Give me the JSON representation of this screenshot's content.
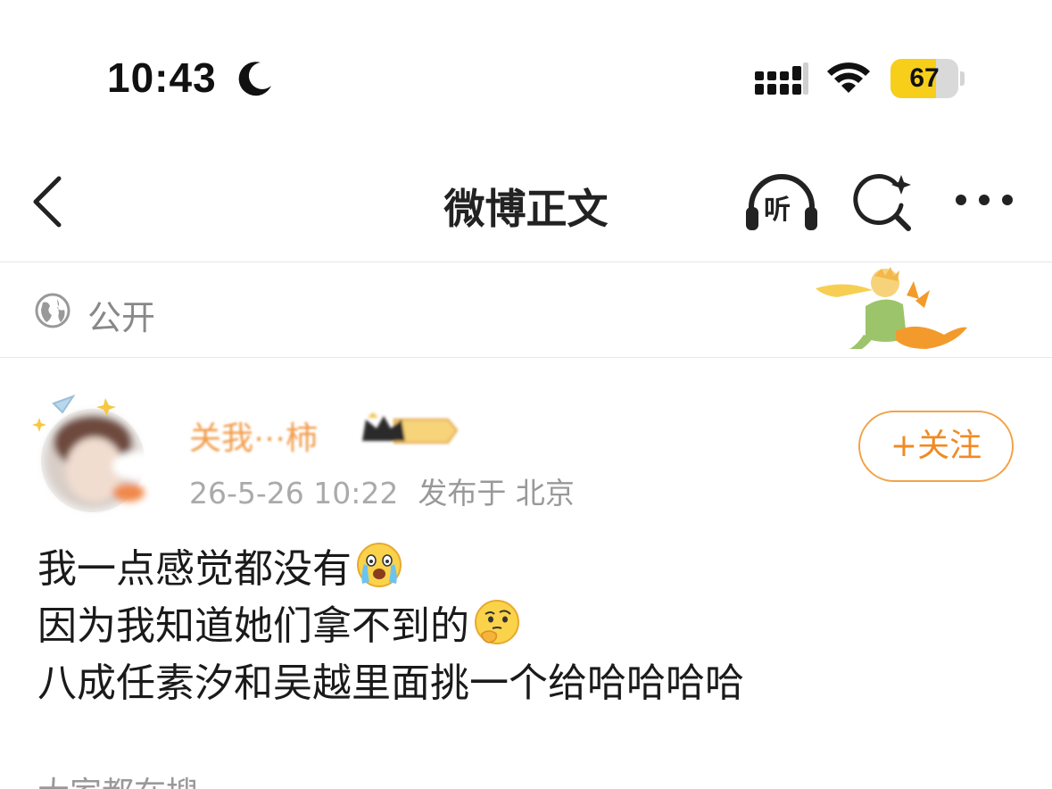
{
  "status_bar": {
    "time": "10:43",
    "moon_icon": "moon-icon",
    "signal_icon": "cellular-signal-icon",
    "wifi_icon": "wifi-icon",
    "battery_percent": "67",
    "battery_level": 0.67,
    "battery_color": "#f7cf1b"
  },
  "nav": {
    "back_icon": "chevron-left-icon",
    "title": "微博正文",
    "listen_label": "听",
    "listen_icon": "headphones-icon",
    "ai_search_icon": "ai-search-icon",
    "more_icon": "more-dots-icon"
  },
  "visibility": {
    "icon": "globe-icon",
    "label": "公开"
  },
  "post": {
    "author_name": "关我⋯柿",
    "date": "26-5-26 10:22",
    "location": "发布于 北京",
    "follow_label": "+关注",
    "accent_color": "#f08a24",
    "lines": [
      "我一点感觉都没有",
      "因为我知道她们拿不到的",
      "八成任素汐和吴越里面挑一个给哈哈哈哈"
    ],
    "emoji_1": "crying-face-emoji",
    "emoji_2": "thinking-face-emoji"
  },
  "bottom": {
    "hot_label": "大家都在搜"
  }
}
